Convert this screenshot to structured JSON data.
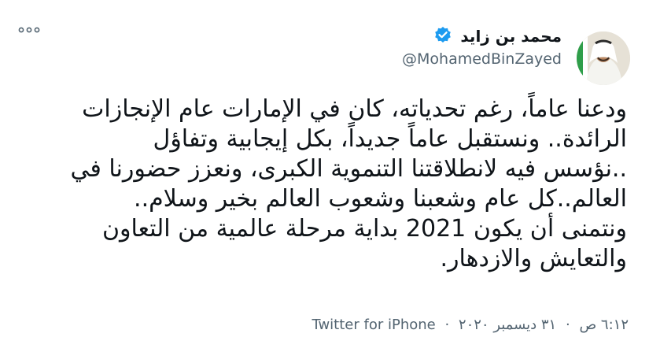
{
  "author": {
    "name": "محمد بن زايد",
    "handle": "@MohamedBinZayed",
    "verified": true,
    "avatar_icon": "profile-photo"
  },
  "tweet": {
    "lines": [
      "ودعنا عاماً، رغم تحدياته، كان في الإمارات عام الإنجازات",
      "الرائدة.. ونستقبل عاماً جديداً، بكل إيجابية وتفاؤل",
      "..نؤسس فيه لانطلاقتنا التنموية الكبرى، ونعزز حضورنا في",
      "العالم..كل عام وشعبنا وشعوب العالم بخير  وسلام..",
      "ونتمنى أن يكون 2021 بداية مرحلة عالمية من التعاون",
      "والتعايش والازدهار."
    ]
  },
  "meta": {
    "time": "٦:١٢ ص",
    "date": "٣١ ديسمبر ٢٠٢٠",
    "separator": "·",
    "source": "Twitter for iPhone"
  },
  "icons": {
    "verified": "verified-badge-icon",
    "more": "more-options-icon"
  },
  "colors": {
    "text": "#0f1419",
    "secondary": "#536471",
    "verified_blue": "#1d9bf0"
  }
}
